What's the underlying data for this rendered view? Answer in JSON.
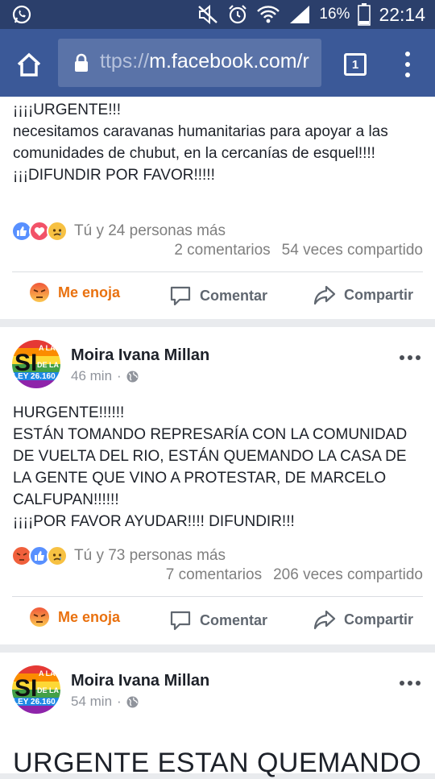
{
  "status_bar": {
    "battery_percent": "16%",
    "time": "22:14",
    "icons": [
      "whatsapp-icon",
      "mute-icon",
      "alarm-icon",
      "wifi-icon",
      "signal-icon",
      "battery-icon"
    ]
  },
  "browser": {
    "url_prefix": "ttps://",
    "url_host": "m.facebook.com/r",
    "tab_count": "1"
  },
  "post1": {
    "text": "¡¡¡¡URGENTE!!!\nnecesitamos caravanas humanitarias para apoyar a las comunidades de chubut, en la cercanías de esquel!!!!\n¡¡¡DIFUNDIR POR FAVOR!!!!!",
    "reaction_summary": "Tú y 24 personas más",
    "comments": "2 comentarios",
    "shares": "54 veces compartido",
    "reaction_icons": [
      "like-reaction-icon",
      "love-reaction-icon",
      "sad-reaction-icon"
    ]
  },
  "post2": {
    "author": "Moira Ivana Millan",
    "time": "46 min",
    "text": "HURGENTE!!!!!!\nESTÁN TOMANDO REPRESARÍA CON LA COMUNIDAD DE VUELTA DEL RIO, ESTÁN QUEMANDO LA CASA DE LA GENTE QUE VINO A PROTESTAR, DE MARCELO CALFUPAN!!!!!!\n¡¡¡¡POR FAVOR AYUDAR!!!! DIFUNDIR!!!",
    "reaction_summary": "Tú y 73 personas más",
    "comments": "7 comentarios",
    "shares": "206 veces compartido",
    "reaction_icons": [
      "angry-reaction-icon",
      "like-reaction-icon",
      "sad-reaction-icon"
    ]
  },
  "post3": {
    "author": "Moira Ivana Millan",
    "time": "54 min",
    "text_preview": "URGENTE ESTAN QUEMANDO"
  },
  "actions": {
    "react": "Me enoja",
    "comment": "Comentar",
    "share": "Compartir"
  },
  "avatar_text": {
    "big": "SI",
    "line1": "A LA",
    "line2": "DE LA",
    "line3": "LEY 26.160"
  },
  "colors": {
    "facebook_blue": "#3b5998",
    "status_bar": "#2b3f6b",
    "angry_orange": "#e9710f",
    "text_gray": "#7f7f7f"
  }
}
